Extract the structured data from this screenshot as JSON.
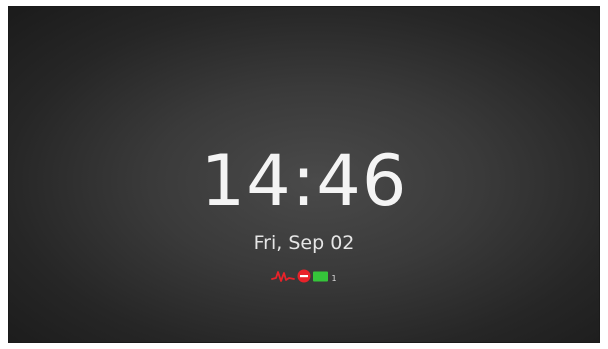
{
  "lockscreen": {
    "time": "14:46",
    "date": "Fri, Sep 02"
  },
  "status_icons": [
    {
      "name": "signal-wave-icon",
      "color": "#e8222a"
    },
    {
      "name": "do-not-disturb-icon",
      "color": "#e8222a"
    },
    {
      "name": "battery-icon",
      "color": "#35c53a"
    }
  ],
  "status_badge": "1"
}
